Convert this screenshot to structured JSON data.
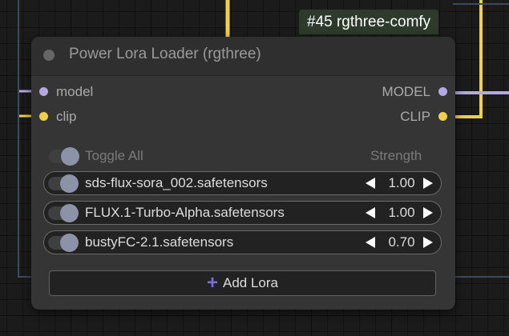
{
  "badge": {
    "text": "#45 rgthree-comfy"
  },
  "node": {
    "title": "Power Lora Loader (rgthree)",
    "inputs": [
      {
        "label": "model",
        "color": "#b3a8e0"
      },
      {
        "label": "clip",
        "color": "#f0d04a"
      }
    ],
    "outputs": [
      {
        "label": "MODEL",
        "color": "#b3a8e0"
      },
      {
        "label": "CLIP",
        "color": "#f0d04a"
      }
    ],
    "toggle_all_label": "Toggle All",
    "strength_header": "Strength",
    "loras": [
      {
        "name": "sds-flux-sora_002.safetensors",
        "strength": "1.00",
        "enabled": true
      },
      {
        "name": "FLUX.1-Turbo-Alpha.safetensors",
        "strength": "1.00",
        "enabled": true
      },
      {
        "name": "bustyFC-2.1.safetensors",
        "strength": "0.70",
        "enabled": true
      }
    ],
    "add_button_label": "Add Lora"
  },
  "colors": {
    "wire_clip": "#f0d04a",
    "wire_model": "#b3a8e0",
    "badge_bg": "#2d3a2c"
  }
}
